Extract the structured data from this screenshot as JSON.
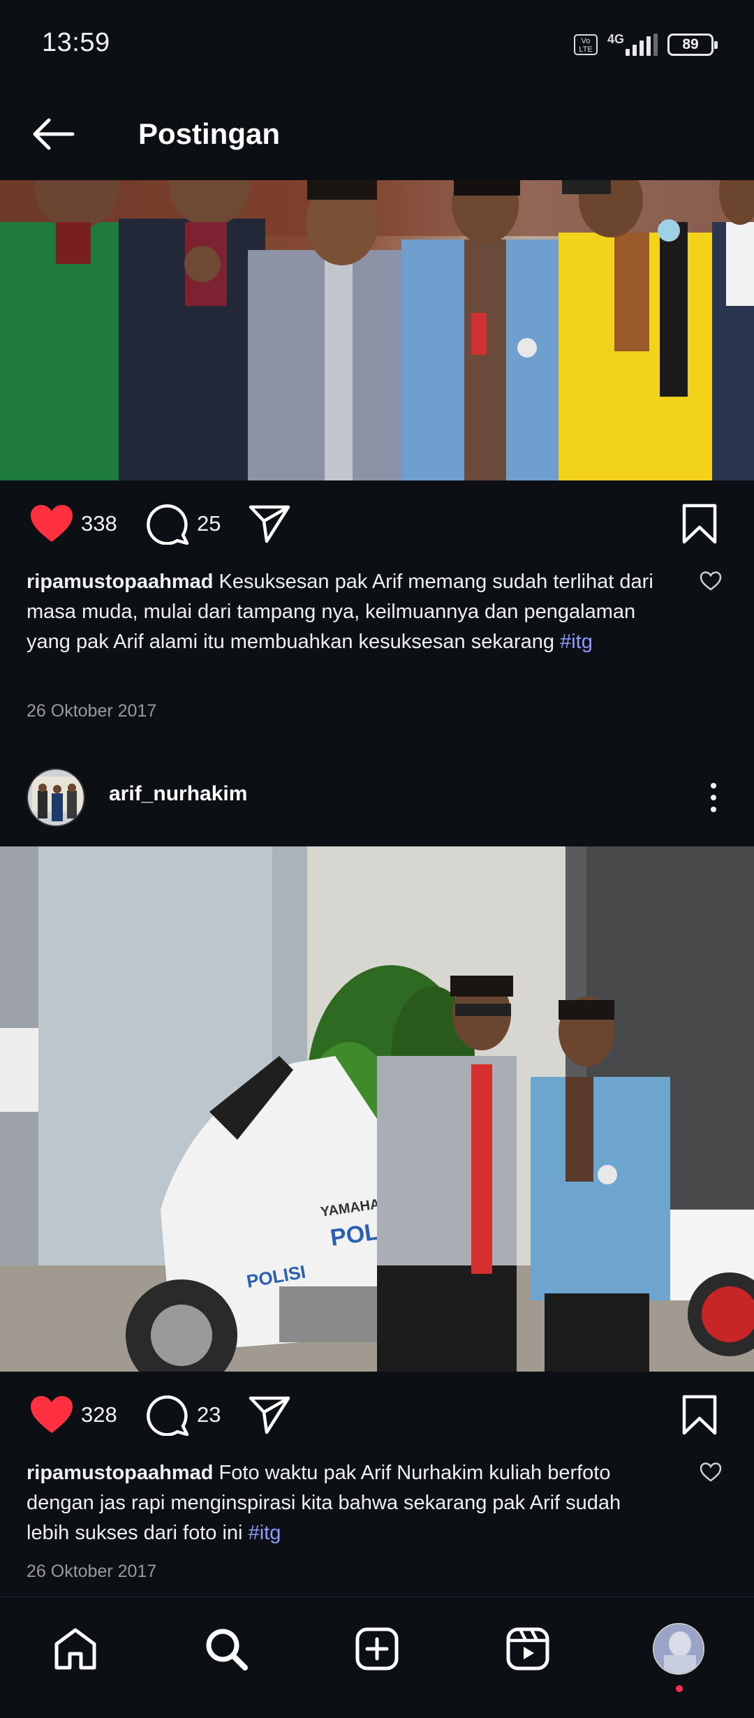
{
  "status_bar": {
    "time": "13:59",
    "volte_label": "Vo LTE",
    "network_type": "4G",
    "battery_level": "89",
    "signal_bars": 4
  },
  "header": {
    "back_icon": "arrow-left-icon",
    "title": "Postingan"
  },
  "posts": [
    {
      "likes": "338",
      "comments": "25",
      "caption_user": "ripamustopaahmad",
      "caption_text": " Kesuksesan pak Arif memang sudah terlihat dari masa muda, mulai dari tampang nya, keilmuannya dan pengalaman yang pak Arif alami itu membuahkan kesuksesan sekarang ",
      "caption_tag": "#itg",
      "date": "26 Oktober 2017"
    },
    {
      "author": "arif_nurhakim",
      "likes": "328",
      "comments": "23",
      "caption_user": "ripamustopaahmad",
      "caption_text": " Foto waktu pak Arif Nurhakim kuliah berfoto dengan jas rapi menginspirasi kita bahwa sekarang pak Arif sudah lebih sukses dari foto ini ",
      "caption_tag": "#itg",
      "date": "26 Oktober 2017"
    }
  ],
  "photo_text": {
    "bike_brand": "YAMAHA",
    "bike_label": "POLISI"
  },
  "bottom_nav": {
    "items": [
      "home-icon",
      "search-icon",
      "create-icon",
      "reels-icon",
      "profile-avatar"
    ]
  },
  "colors": {
    "background": "#0c0f14",
    "like_red": "#ff3040",
    "hashtag": "#8e9bff",
    "notification_dot": "#ff2d55"
  }
}
